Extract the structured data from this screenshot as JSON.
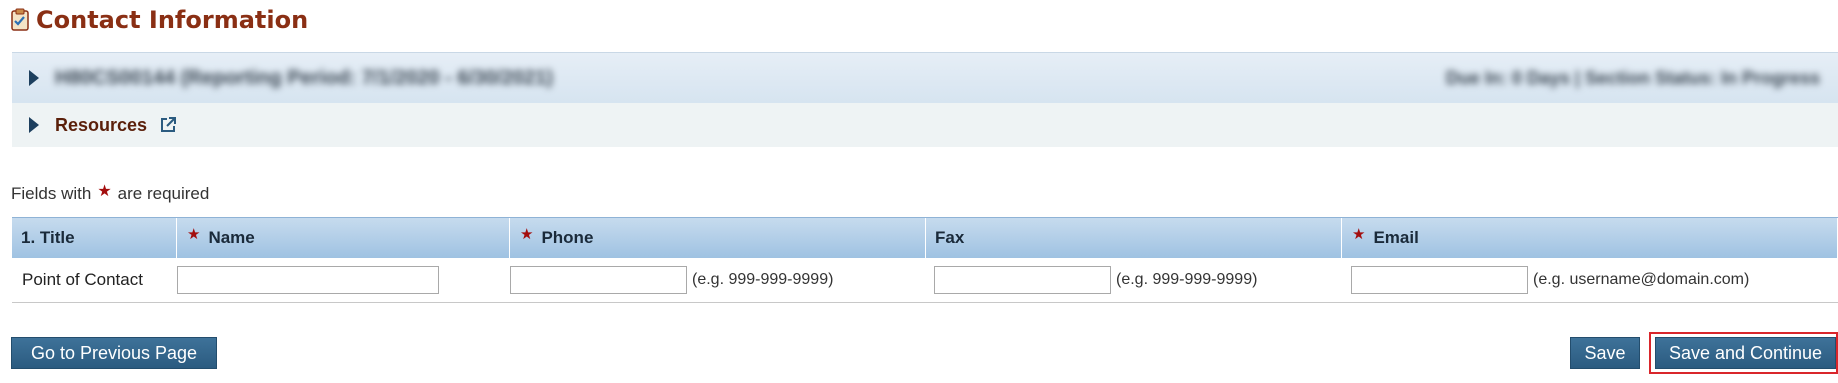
{
  "page": {
    "title": "Contact Information",
    "title_icon": "clipboard-icon",
    "accent_color": "#8a2f14"
  },
  "info_bar": {
    "left_text": "H80CS00144 (Reporting Period: 7/1/2020 - 6/30/2021)",
    "right_text": "Due In: 0 Days | Section Status: In Progress"
  },
  "resources": {
    "label": "Resources",
    "icon": "external-link-icon"
  },
  "required_note": {
    "prefix": "Fields with",
    "star": "★",
    "suffix": "are required"
  },
  "table": {
    "headers": {
      "title": "1. Title",
      "name": "Name",
      "phone": "Phone",
      "fax": "Fax",
      "email": "Email"
    },
    "required_star": "★",
    "rows": [
      {
        "title": "Point of Contact",
        "name": "",
        "phone": "",
        "phone_hint": "(e.g. 999-999-9999)",
        "fax": "",
        "fax_hint": "(e.g. 999-999-9999)",
        "email": "",
        "email_hint": "(e.g. username@domain.com)"
      }
    ]
  },
  "buttons": {
    "previous": "Go to Previous Page",
    "save": "Save",
    "save_continue": "Save and Continue"
  },
  "colors": {
    "button": "#2b5b80",
    "highlight": "#d9262b",
    "required_star": "#a30d0d"
  }
}
